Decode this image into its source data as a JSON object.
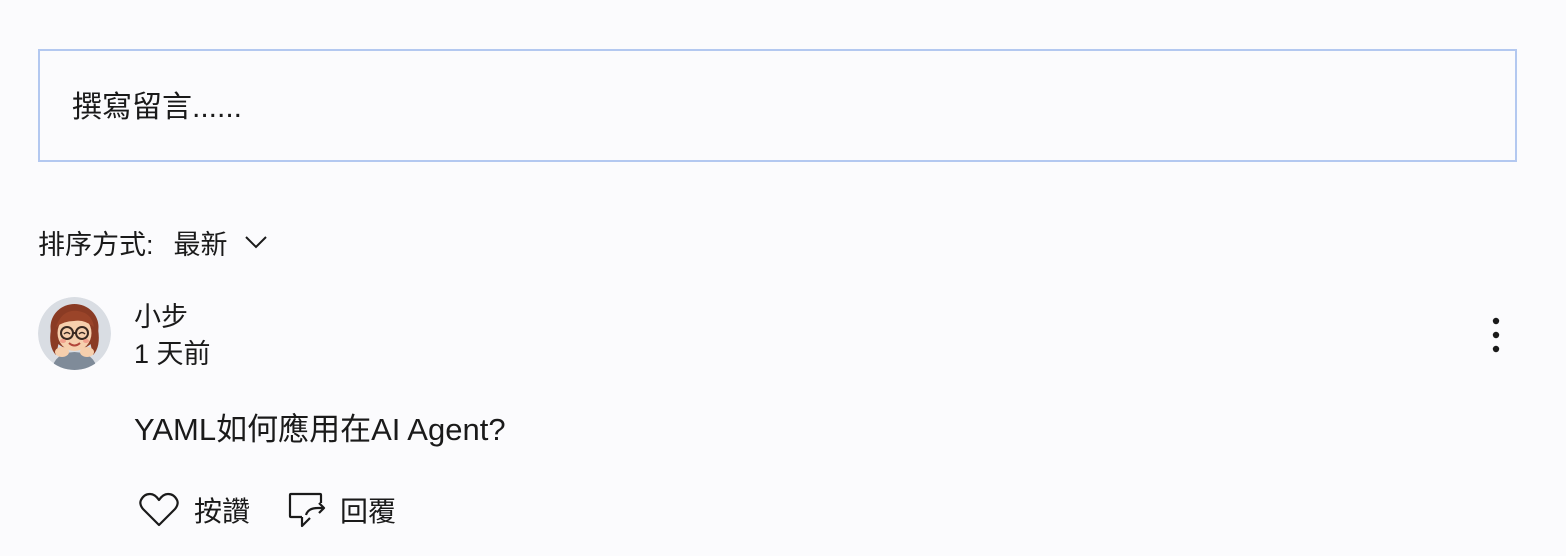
{
  "comment_input": {
    "placeholder": "撰寫留言......"
  },
  "sort": {
    "label": "排序方式:",
    "selected": "最新"
  },
  "comment": {
    "author": "小步",
    "time": "1 天前",
    "text": "YAML如何應用在AI Agent?",
    "like_label": "按讚",
    "reply_label": "回覆"
  },
  "icons": {
    "sort_chevron": "chevron-down-icon",
    "more": "more-vertical-icon",
    "like": "heart-icon",
    "reply": "reply-icon"
  }
}
